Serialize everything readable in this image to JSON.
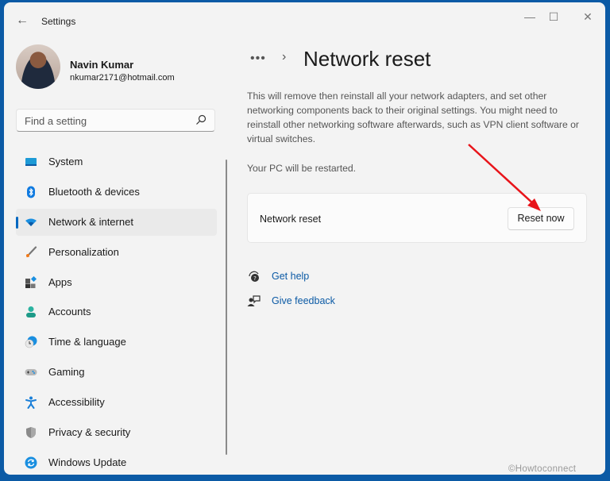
{
  "window": {
    "title": "Settings",
    "controls": {
      "minimize": "—",
      "maximize": "☐",
      "close": "✕"
    }
  },
  "user": {
    "name": "Navin Kumar",
    "email": "nkumar2171@hotmail.com"
  },
  "search": {
    "placeholder": "Find a setting"
  },
  "sidebar": {
    "items": [
      {
        "label": "System",
        "icon": "monitor-icon",
        "active": false
      },
      {
        "label": "Bluetooth & devices",
        "icon": "bluetooth-icon",
        "active": false
      },
      {
        "label": "Network & internet",
        "icon": "wifi-icon",
        "active": true
      },
      {
        "label": "Personalization",
        "icon": "brush-icon",
        "active": false
      },
      {
        "label": "Apps",
        "icon": "apps-icon",
        "active": false
      },
      {
        "label": "Accounts",
        "icon": "person-icon",
        "active": false
      },
      {
        "label": "Time & language",
        "icon": "globe-clock-icon",
        "active": false
      },
      {
        "label": "Gaming",
        "icon": "gamepad-icon",
        "active": false
      },
      {
        "label": "Accessibility",
        "icon": "accessibility-icon",
        "active": false
      },
      {
        "label": "Privacy & security",
        "icon": "shield-icon",
        "active": false
      },
      {
        "label": "Windows Update",
        "icon": "update-icon",
        "active": false
      }
    ]
  },
  "main": {
    "breadcrumb_more": "•••",
    "breadcrumb_sep": "›",
    "title": "Network reset",
    "description": "This will remove then reinstall all your network adapters, and set other networking components back to their original settings. You might need to reinstall other networking software afterwards, such as VPN client software or virtual switches.",
    "restart_note": "Your PC will be restarted.",
    "card": {
      "label": "Network reset",
      "button": "Reset now"
    },
    "links": [
      {
        "label": "Get help",
        "icon": "help-icon"
      },
      {
        "label": "Give feedback",
        "icon": "feedback-icon"
      }
    ]
  },
  "annotation": {
    "arrow_color": "#e8141a"
  },
  "watermark": "©Howtoconnect",
  "colors": {
    "accent": "#0067c0",
    "link": "#0b5aa5",
    "desktop": "#0b5aa5"
  }
}
